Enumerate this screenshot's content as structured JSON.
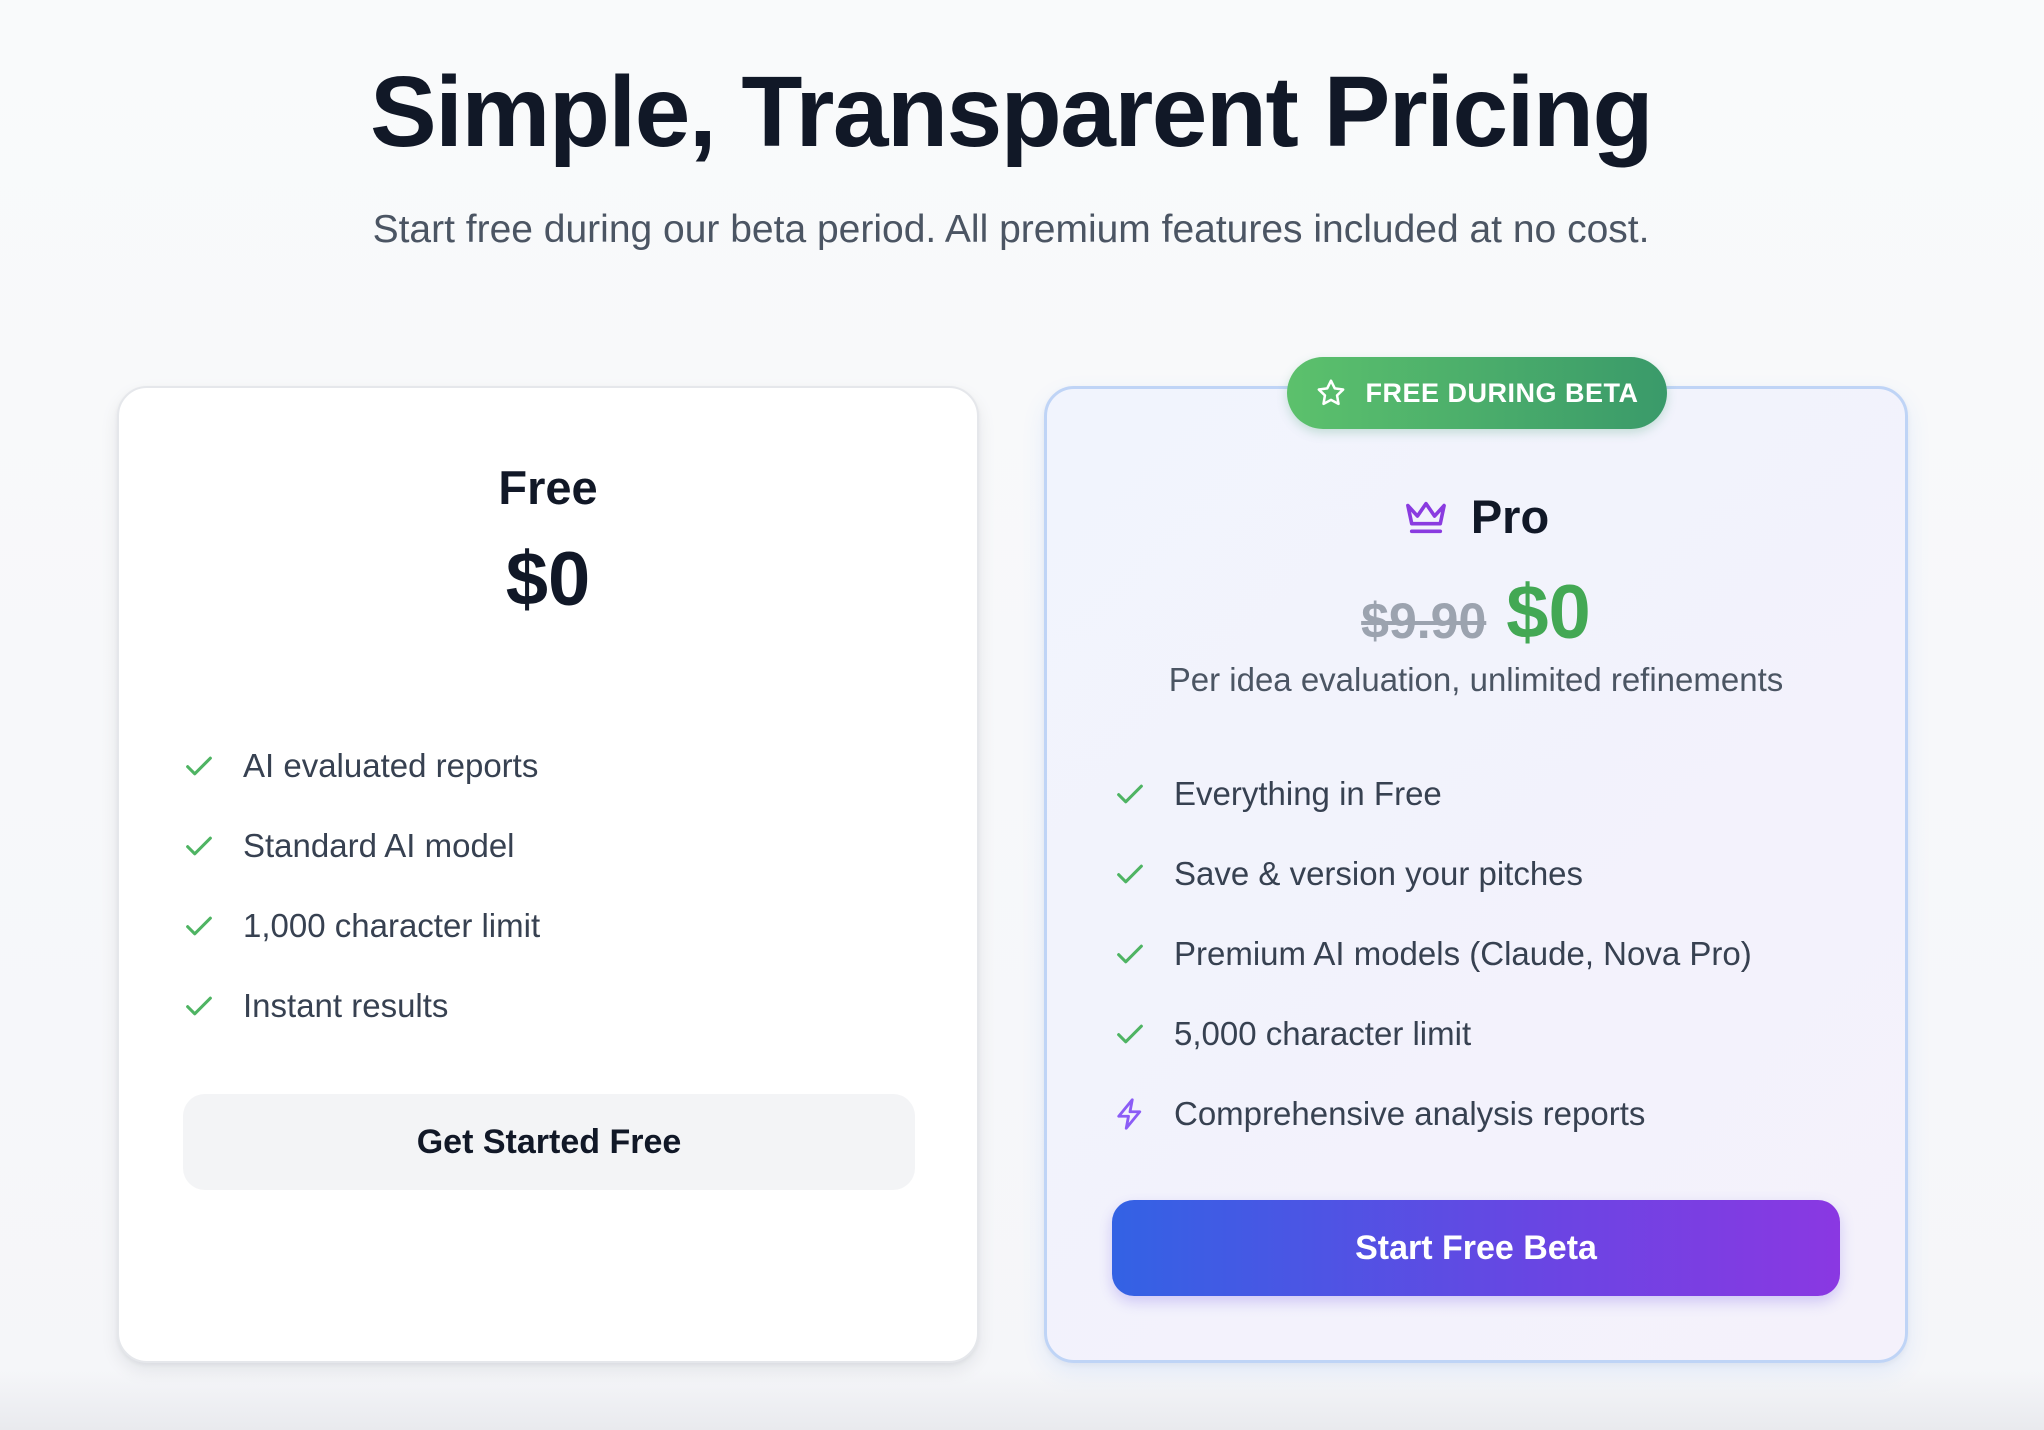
{
  "hero": {
    "title": "Simple, Transparent Pricing",
    "subtitle": "Start free during our beta period. All premium features included at no cost."
  },
  "plans": {
    "free": {
      "name": "Free",
      "price": "$0",
      "features": [
        {
          "label": "AI evaluated reports",
          "icon": "check-icon"
        },
        {
          "label": "Standard AI model",
          "icon": "check-icon"
        },
        {
          "label": "1,000 character limit",
          "icon": "check-icon"
        },
        {
          "label": "Instant results",
          "icon": "check-icon"
        }
      ],
      "button_label": "Get Started Free"
    },
    "pro": {
      "badge": "FREE DURING BETA",
      "badge_icon": "star-icon",
      "name": "Pro",
      "name_icon": "crown-icon",
      "old_price": "$9.90",
      "price": "$0",
      "note": "Per idea evaluation, unlimited refinements",
      "features": [
        {
          "label": "Everything in Free",
          "icon": "check-icon"
        },
        {
          "label": "Save & version your pitches",
          "icon": "check-icon"
        },
        {
          "label": "Premium AI models (Claude, Nova Pro)",
          "icon": "check-icon"
        },
        {
          "label": "5,000 character limit",
          "icon": "check-icon"
        },
        {
          "label": "Comprehensive analysis reports",
          "icon": "lightning-icon"
        }
      ],
      "button_label": "Start Free Beta"
    }
  },
  "colors": {
    "check": "#4fb463",
    "lightning": "#8b5cf6",
    "crown": "#8a3be0",
    "pro_price": "#43a854",
    "button_gradient_start": "#3362e4",
    "button_gradient_end": "#8a38e2",
    "badge_gradient_start": "#5cc16c",
    "badge_gradient_end": "#3a9a6a"
  }
}
